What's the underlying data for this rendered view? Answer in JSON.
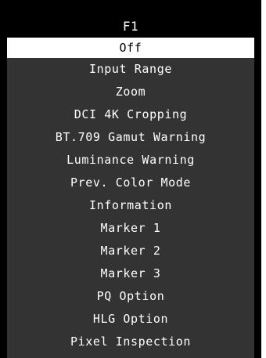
{
  "osd": {
    "header_title": "F1",
    "items": [
      {
        "label": "Off",
        "selected": true
      },
      {
        "label": "Input Range",
        "selected": false
      },
      {
        "label": "Zoom",
        "selected": false
      },
      {
        "label": "DCI 4K Cropping",
        "selected": false
      },
      {
        "label": "BT.709 Gamut Warning",
        "selected": false
      },
      {
        "label": "Luminance Warning",
        "selected": false
      },
      {
        "label": "Prev. Color Mode",
        "selected": false
      },
      {
        "label": "Information",
        "selected": false
      },
      {
        "label": "Marker 1",
        "selected": false
      },
      {
        "label": "Marker 2",
        "selected": false
      },
      {
        "label": "Marker 3",
        "selected": false
      },
      {
        "label": "PQ Option",
        "selected": false
      },
      {
        "label": "HLG Option",
        "selected": false
      },
      {
        "label": "Pixel Inspection",
        "selected": false
      }
    ]
  },
  "colors": {
    "frame": "#000000",
    "panel": "#333333",
    "selected_bg": "#ffffff",
    "selected_text": "#000000",
    "text": "#ffffff"
  }
}
